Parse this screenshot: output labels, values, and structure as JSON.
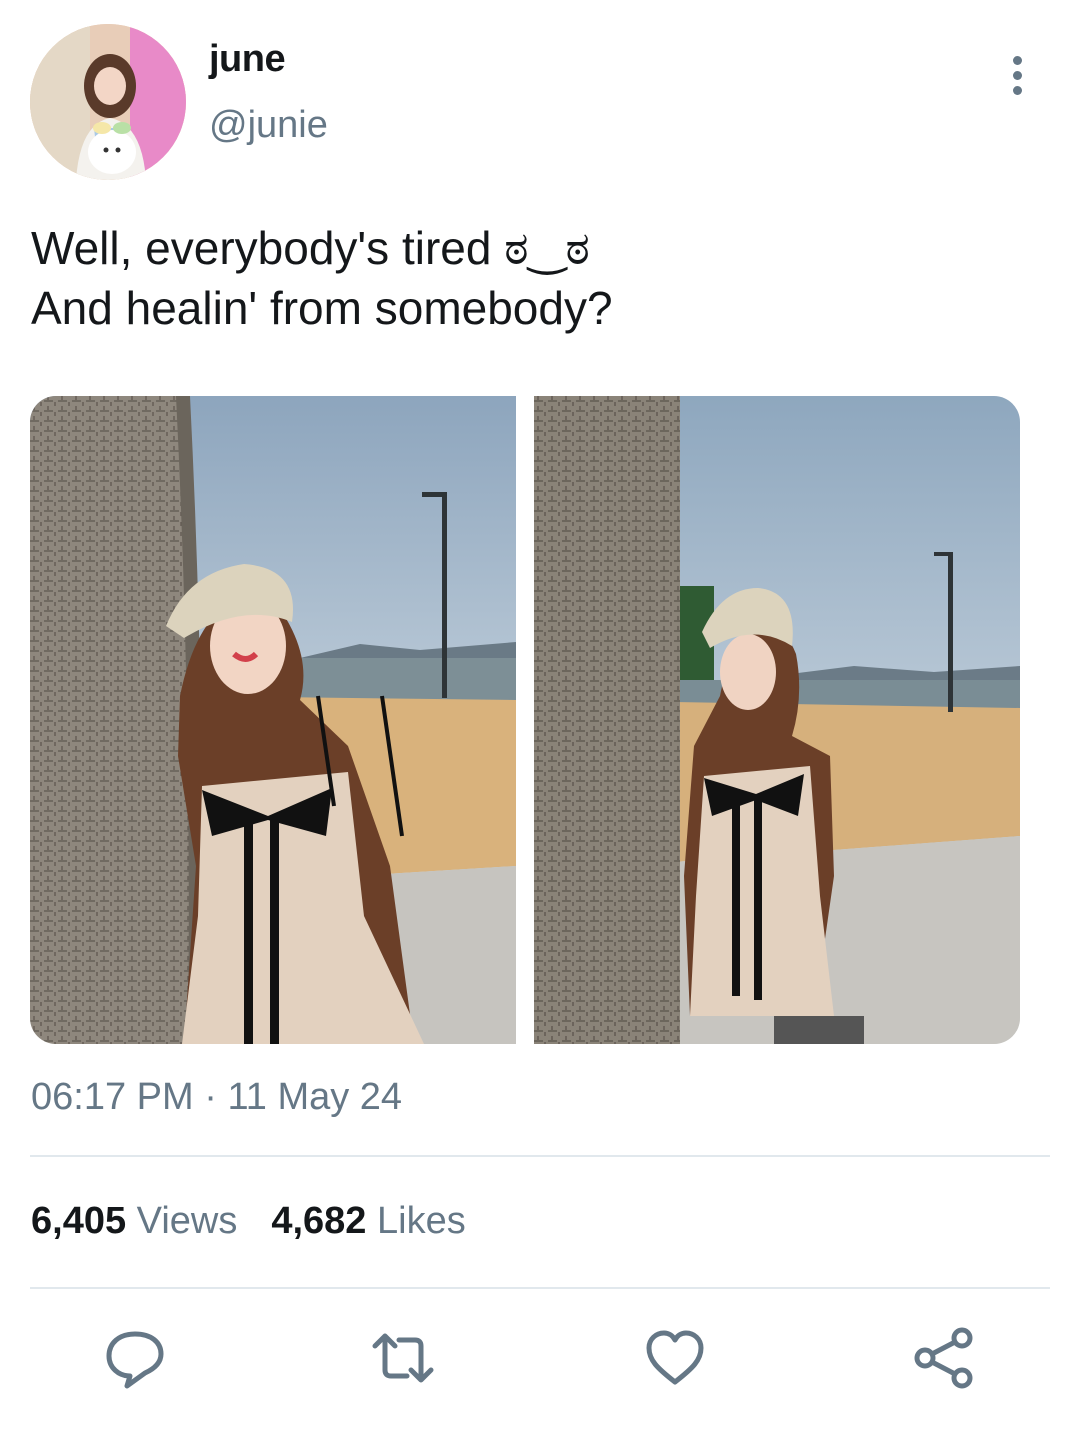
{
  "user": {
    "display_name": "june",
    "handle": "@junie"
  },
  "tweet": {
    "lines": [
      "Well, everybody's tired ಠ‿ಠ",
      "And healin' from somebody?"
    ],
    "time": "06:17 PM",
    "separator": "·",
    "date": "11 May 24"
  },
  "stats": {
    "views_count": "6,405",
    "views_label": "Views",
    "likes_count": "4,682",
    "likes_label": "Likes"
  },
  "icons": [
    "more-vertical-icon",
    "reply-icon",
    "retweet-icon",
    "like-icon",
    "share-icon"
  ],
  "colors": {
    "text": "#14171a",
    "secondary": "#657786",
    "divider": "#e1e8ed"
  }
}
